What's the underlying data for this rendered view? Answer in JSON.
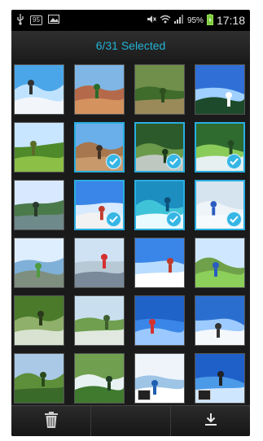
{
  "status_bar": {
    "badge": "95",
    "battery": "95%",
    "time": "17:18",
    "icons": [
      "usb-icon",
      "badge-icon",
      "image-icon",
      "mute-icon",
      "wifi-icon",
      "signal-icon",
      "battery-icon"
    ]
  },
  "header": {
    "title": "6/31 Selected"
  },
  "accent_color": "#2aaee0",
  "gallery": {
    "rows": 6,
    "columns": 4,
    "thumbnails": [
      {
        "scene": "snow-ski-jump",
        "selected": false,
        "video": false
      },
      {
        "scene": "canyon-cyclist",
        "selected": false,
        "video": false
      },
      {
        "scene": "forest-path-hikers",
        "selected": false,
        "video": false
      },
      {
        "scene": "sun-through-trees",
        "selected": false,
        "video": false
      },
      {
        "scene": "green-trail",
        "selected": false,
        "video": false
      },
      {
        "scene": "rock-climbers",
        "selected": true,
        "video": false
      },
      {
        "scene": "forest-stream",
        "selected": true,
        "video": false
      },
      {
        "scene": "waterfall-ravine",
        "selected": true,
        "video": false
      },
      {
        "scene": "river-picnic",
        "selected": false,
        "video": false
      },
      {
        "scene": "frisbee-jump",
        "selected": true,
        "video": false
      },
      {
        "scene": "surfer-wave",
        "selected": true,
        "video": false
      },
      {
        "scene": "snow-campers",
        "selected": true,
        "video": false
      },
      {
        "scene": "park-road",
        "selected": false,
        "video": false
      },
      {
        "scene": "red-bridge",
        "selected": false,
        "video": false
      },
      {
        "scene": "snowboarder",
        "selected": false,
        "video": false
      },
      {
        "scene": "blue-tent",
        "selected": false,
        "video": false
      },
      {
        "scene": "mountain-hikers",
        "selected": false,
        "video": false
      },
      {
        "scene": "stadium-valley",
        "selected": false,
        "video": false
      },
      {
        "scene": "skydivers",
        "selected": false,
        "video": false
      },
      {
        "scene": "snowy-mountain-ski",
        "selected": false,
        "video": false
      },
      {
        "scene": "palm-forest",
        "selected": false,
        "video": false
      },
      {
        "scene": "waterfall-garden",
        "selected": false,
        "video": false
      },
      {
        "scene": "snowboard-trick",
        "selected": false,
        "video": true
      },
      {
        "scene": "sky-jump",
        "selected": false,
        "video": true
      }
    ]
  },
  "bottom_bar": {
    "buttons": [
      {
        "icon": "trash-icon",
        "action": "delete"
      },
      {
        "icon": "",
        "action": "empty"
      },
      {
        "icon": "download-icon",
        "action": "download"
      }
    ]
  }
}
